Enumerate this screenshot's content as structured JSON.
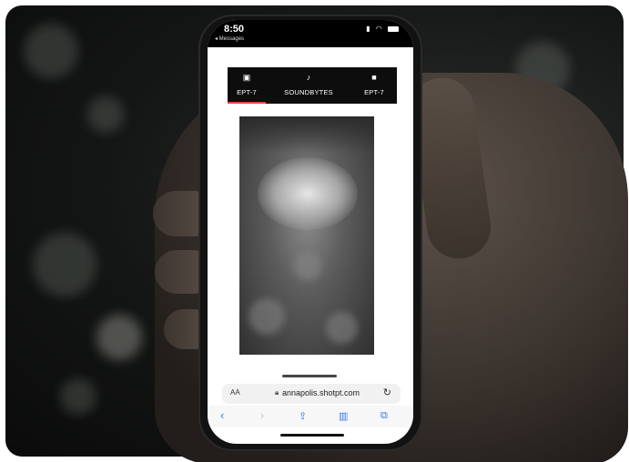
{
  "status_bar": {
    "time": "8:50",
    "back_label": "◂ Messages"
  },
  "app_tabs": [
    {
      "label": "EPT-7",
      "icon": "image-icon",
      "active": true
    },
    {
      "label": "SOUNDBYTES",
      "icon": "music-note-icon",
      "active": false
    },
    {
      "label": "EPT-7",
      "icon": "video-camera-icon",
      "active": false
    }
  ],
  "browser": {
    "text_size_label": "AA",
    "url": "annapolis.shotpt.com",
    "reload_icon": "reload-icon"
  },
  "toolbar_icons": [
    "back-chevron-icon",
    "forward-chevron-icon",
    "share-icon",
    "bookmarks-icon",
    "tabs-icon"
  ],
  "colors": {
    "tab_active_underline": "#e34a3b",
    "toolbar_accent": "#3478f6"
  }
}
